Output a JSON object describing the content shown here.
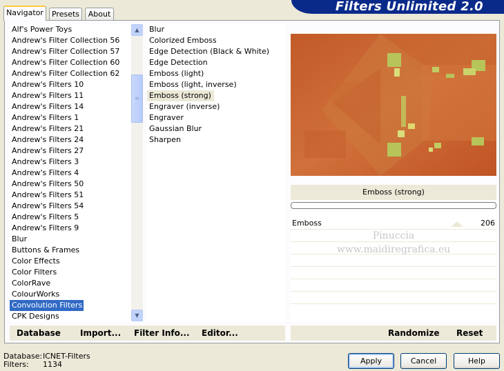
{
  "tabs": [
    "Navigator",
    "Presets",
    "About"
  ],
  "banner": "Filters Unlimited 2.0",
  "categories": [
    "Alf's Power Toys",
    "Andrew's Filter Collection 56",
    "Andrew's Filter Collection 57",
    "Andrew's Filter Collection 60",
    "Andrew's Filter Collection 62",
    "Andrew's Filters 10",
    "Andrew's Filters 11",
    "Andrew's Filters 14",
    "Andrew's Filters 1",
    "Andrew's Filters 21",
    "Andrew's Filters 24",
    "Andrew's Filters 27",
    "Andrew's Filters 3",
    "Andrew's Filters 4",
    "Andrew's Filters 50",
    "Andrew's Filters 51",
    "Andrew's Filters 54",
    "Andrew's Filters 5",
    "Andrew's Filters 9",
    "Blur",
    "Buttons & Frames",
    "Color Effects",
    "Color Filters",
    "ColorRave",
    "ColourWorks",
    "Convolution Filters",
    "CPK Designs"
  ],
  "selected_category": "Convolution Filters",
  "filters": [
    "Blur",
    "Colorized Emboss",
    "Edge Detection (Black & White)",
    "Edge Detection",
    "Emboss (light)",
    "Emboss (light, inverse)",
    "Emboss (strong)",
    "Engraver (inverse)",
    "Engraver",
    "Gaussian Blur",
    "Sharpen"
  ],
  "selected_filter": "Emboss (strong)",
  "left_buttons": {
    "database": "Database",
    "import": "Import...",
    "filter_info": "Filter Info...",
    "editor": "Editor..."
  },
  "right_buttons": {
    "randomize": "Randomize",
    "reset": "Reset"
  },
  "control": {
    "title": "Emboss (strong)",
    "param_label": "Emboss",
    "param_value": "206"
  },
  "watermark": [
    "Pinuccia",
    "www.maidiregrafica.eu"
  ],
  "footer": {
    "database_label": "Database:",
    "database_value": "ICNET-Filters",
    "filters_label": "Filters:",
    "filters_value": "1134"
  },
  "dialog_buttons": {
    "apply": "Apply",
    "cancel": "Cancel",
    "help": "Help"
  },
  "colors": {
    "selection": "#316ac5",
    "banner": "#0a2a8a",
    "preview_base": "#c8602c",
    "emboss_highlight": "#b7c45a"
  }
}
